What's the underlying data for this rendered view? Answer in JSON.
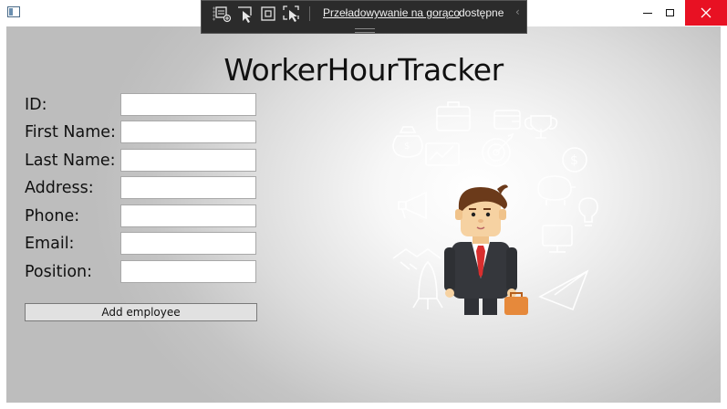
{
  "window": {
    "colors": {
      "close_bg": "#e81123",
      "devbar_bg": "#2b2b2b"
    }
  },
  "devbar": {
    "tools": [
      "add-element-icon",
      "select-element-icon",
      "display-layout-icon",
      "track-focus-icon"
    ],
    "hot_reload_link": "Przeładowywanie na gorąco",
    "hot_reload_status": "dostępne",
    "collapse_glyph": "‹"
  },
  "app": {
    "title": "WorkerHourTracker",
    "fields": [
      {
        "label": "ID:",
        "value": ""
      },
      {
        "label": "First Name:",
        "value": ""
      },
      {
        "label": "Last Name:",
        "value": ""
      },
      {
        "label": "Address:",
        "value": ""
      },
      {
        "label": "Phone:",
        "value": ""
      },
      {
        "label": "Email:",
        "value": ""
      },
      {
        "label": "Position:",
        "value": ""
      }
    ],
    "add_button": "Add employee",
    "illustration": "businessman-with-briefcase-and-business-icons"
  }
}
